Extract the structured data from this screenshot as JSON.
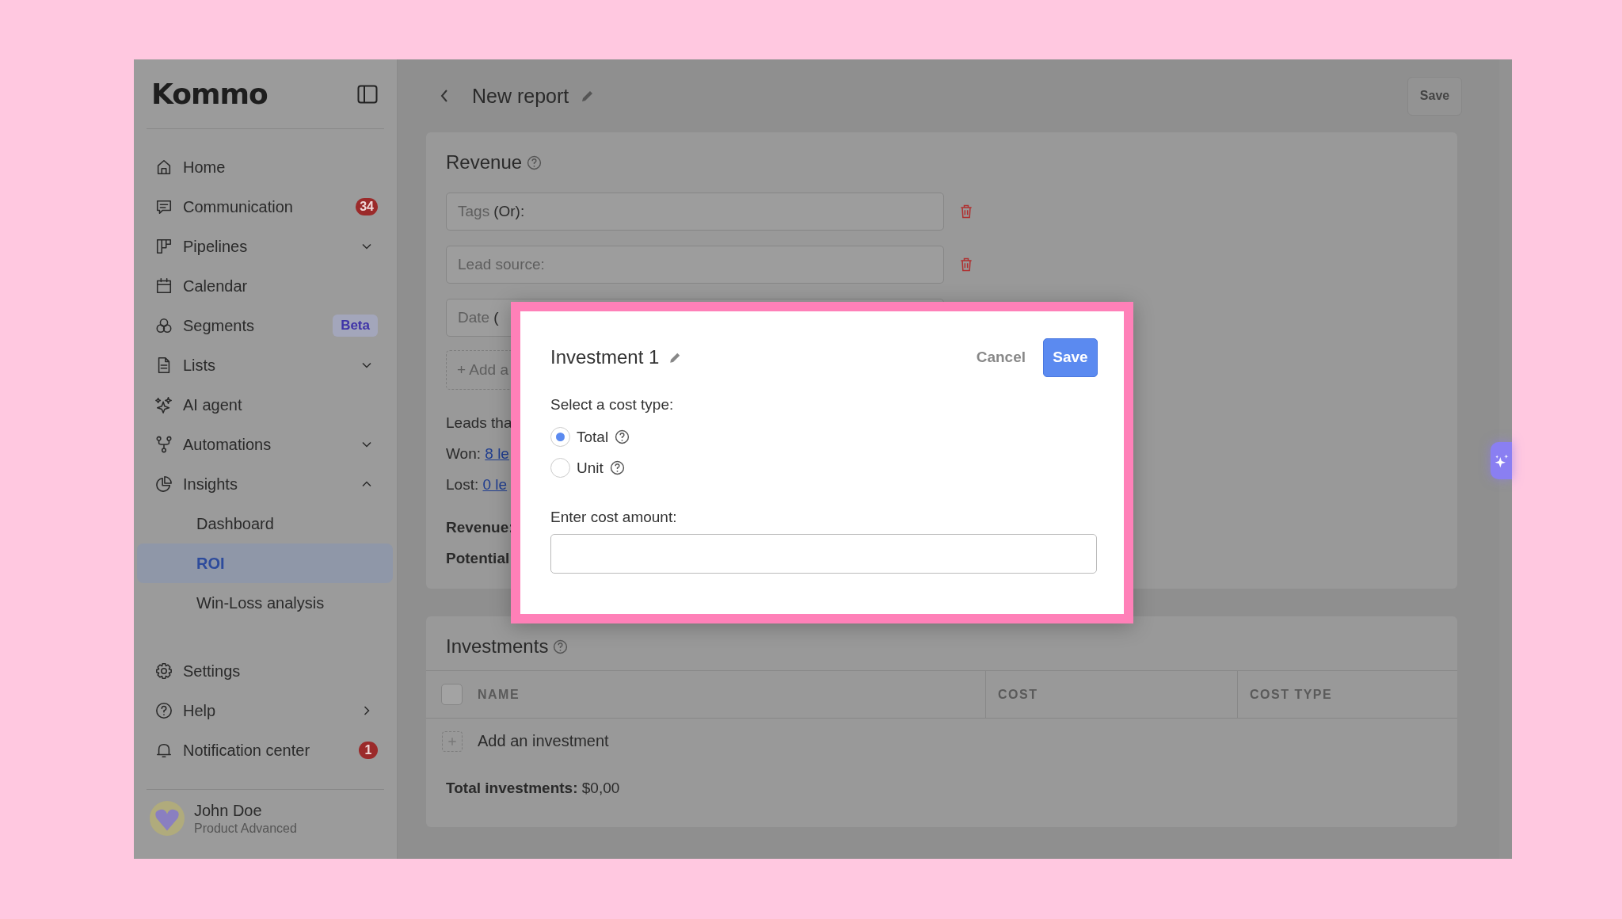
{
  "sidebar": {
    "logo": "Kommo",
    "items": [
      {
        "label": "Home",
        "kind": "link",
        "selected": false
      },
      {
        "label": "Communication",
        "kind": "link",
        "selected": false,
        "badge": {
          "text": "34",
          "kind": "count"
        }
      },
      {
        "label": "Pipelines",
        "kind": "group",
        "selected": false,
        "expanded": false
      },
      {
        "label": "Calendar",
        "kind": "link",
        "selected": false
      },
      {
        "label": "Segments",
        "kind": "link",
        "selected": false,
        "badge": {
          "text": "Beta",
          "kind": "tag"
        }
      },
      {
        "label": "Lists",
        "kind": "group",
        "selected": false,
        "expanded": false
      },
      {
        "label": "AI agent",
        "kind": "link",
        "selected": false
      },
      {
        "label": "Automations",
        "kind": "group",
        "selected": false,
        "expanded": false
      },
      {
        "label": "Insights",
        "kind": "group",
        "selected": false,
        "expanded": true,
        "children": [
          {
            "label": "Dashboard",
            "selected": false
          },
          {
            "label": "ROI",
            "selected": true
          },
          {
            "label": "Win-Loss analysis",
            "selected": false
          }
        ]
      }
    ],
    "footer_items": [
      {
        "label": "Settings",
        "kind": "link",
        "selected": false
      },
      {
        "label": "Help",
        "kind": "submenu",
        "selected": false
      },
      {
        "label": "Notification center",
        "kind": "link",
        "selected": false,
        "badge": {
          "text": "1",
          "kind": "count"
        }
      }
    ],
    "user": {
      "name": "John Doe",
      "plan": "Product Advanced"
    }
  },
  "header": {
    "title": "New report",
    "save": "Save"
  },
  "revenue": {
    "title": "Revenue",
    "filters": [
      {
        "label": "Tags",
        "qualifier": "(Or):",
        "removable": true
      },
      {
        "label": "Lead source:",
        "removable": true
      },
      {
        "label": "Date",
        "qualifier": "("
      }
    ],
    "add": "+ Add a",
    "leads": "Leads tha",
    "outcomes": [
      {
        "label": "Won:",
        "link": "8 le"
      },
      {
        "label": "Lost:",
        "link": "0 le"
      }
    ],
    "totals": [
      "Revenue:",
      "Potential"
    ]
  },
  "investments": {
    "title": "Investments",
    "columns": [
      "NAME",
      "COST",
      "COST TYPE"
    ],
    "select_all": {
      "checked": false
    },
    "add": "Add an investment",
    "total_label": "Total investments:",
    "total_value": "$0,00"
  },
  "modal": {
    "title": "Investment 1",
    "cancel": "Cancel",
    "save": "Save",
    "cost_type_label": "Select a cost type:",
    "options": [
      {
        "label": "Total",
        "selected": true
      },
      {
        "label": "Unit",
        "selected": false
      }
    ],
    "amount_label": "Enter cost amount:"
  }
}
